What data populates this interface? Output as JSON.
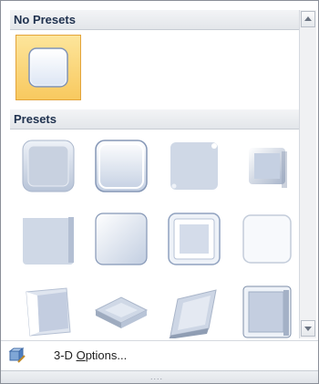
{
  "sections": {
    "no_presets": "No Presets",
    "presets": "Presets"
  },
  "presets": [
    {
      "name": "preset-bevel-circle"
    },
    {
      "name": "preset-bevel-relaxed-inset"
    },
    {
      "name": "preset-bevel-cross"
    },
    {
      "name": "preset-bevel-cool-slant"
    },
    {
      "name": "preset-bevel-angle"
    },
    {
      "name": "preset-bevel-soft-round"
    },
    {
      "name": "preset-bevel-convex"
    },
    {
      "name": "preset-bevel-slope"
    },
    {
      "name": "preset-3d-perspective-left"
    },
    {
      "name": "preset-3d-isometric"
    },
    {
      "name": "preset-3d-perspective-tilt"
    },
    {
      "name": "preset-3d-perspective-right"
    }
  ],
  "footer": {
    "options_pre": "3-D ",
    "options_u": "O",
    "options_post": "ptions...",
    "icon": "format-3d-icon"
  },
  "grip": "....",
  "colors": {
    "selected_fill": "#f8c95f",
    "selected_border": "#e3a43b",
    "header_text": "#20324f",
    "bevel_fill": "#c9d3e4"
  }
}
